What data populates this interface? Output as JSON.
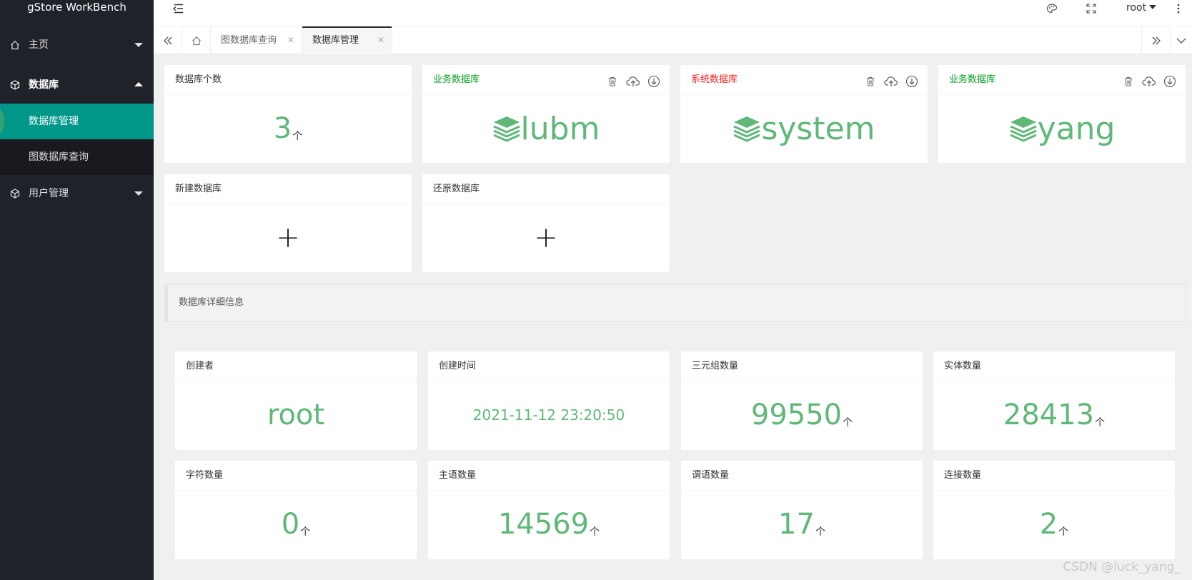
{
  "app": {
    "title": "gStore WorkBench"
  },
  "sidebar": {
    "items": [
      {
        "label": "主页",
        "icon": "home-icon"
      },
      {
        "label": "数据库",
        "icon": "cube-icon",
        "children": [
          {
            "label": "数据库管理"
          },
          {
            "label": "图数据库查询"
          }
        ]
      },
      {
        "label": "用户管理",
        "icon": "cube-icon"
      }
    ]
  },
  "header": {
    "user": "root"
  },
  "tabs": [
    {
      "label": "图数据库查询"
    },
    {
      "label": "数据库管理"
    }
  ],
  "cards": {
    "count": {
      "title": "数据库个数",
      "value": "3",
      "unit": "个"
    },
    "databases": [
      {
        "type": "业务数据库",
        "type_color": "#009f1f",
        "name": "lubm"
      },
      {
        "type": "系统数据库",
        "type_color": "#ff2020",
        "name": "system"
      },
      {
        "type": "业务数据库",
        "type_color": "#009f1f",
        "name": "yang"
      }
    ],
    "create": {
      "title": "新建数据库",
      "symbol": "+"
    },
    "restore": {
      "title": "还原数据库",
      "symbol": "+"
    }
  },
  "details": {
    "heading": "数据库详细信息",
    "creator": {
      "label": "创建者",
      "value": "root"
    },
    "created_time": {
      "label": "创建时间",
      "value": "2021-11-12 23:20:50"
    },
    "triples": {
      "label": "三元组数量",
      "value": "99550",
      "unit": "个"
    },
    "entities": {
      "label": "实体数量",
      "value": "28413",
      "unit": "个"
    },
    "literals": {
      "label": "字符数量",
      "value": "0",
      "unit": "个"
    },
    "subjects": {
      "label": "主语数量",
      "value": "14569",
      "unit": "个"
    },
    "predicates": {
      "label": "谓语数量",
      "value": "17",
      "unit": "个"
    },
    "connections": {
      "label": "连接数量",
      "value": "2",
      "unit": "个"
    }
  },
  "watermark": "CSDN @luck_yang_",
  "colors": {
    "sidebar_bg": "#20222a",
    "accent": "#009688",
    "value_green": "#5FB878"
  }
}
